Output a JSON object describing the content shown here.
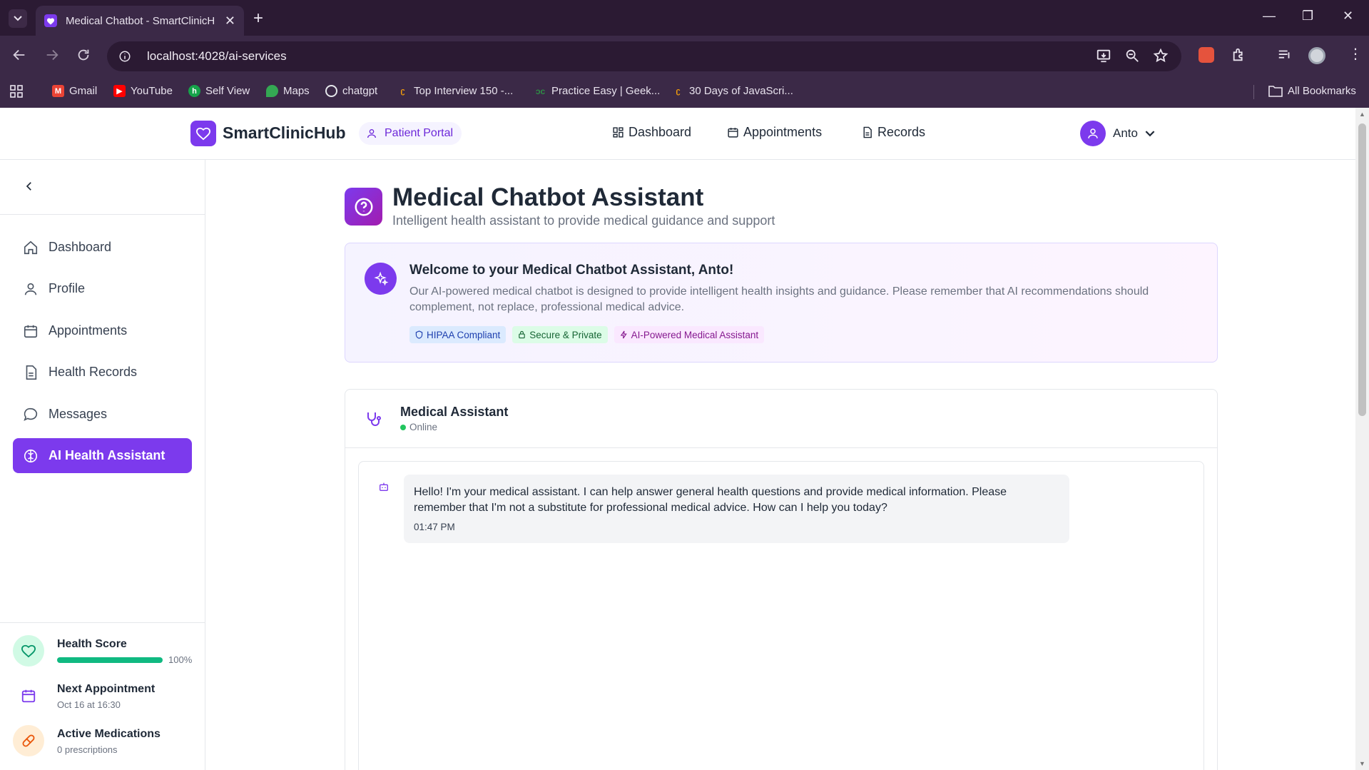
{
  "browser": {
    "tab_title": "Medical Chatbot - SmartClinicH",
    "url": "localhost:4028/ai-services",
    "bookmarks": [
      {
        "label": "Gmail",
        "icon": "gmail-icon",
        "color": "#ea4335"
      },
      {
        "label": "YouTube",
        "icon": "youtube-icon",
        "color": "#ff0000"
      },
      {
        "label": "Self View",
        "icon": "selfview-icon",
        "color": "#16a34a"
      },
      {
        "label": "Maps",
        "icon": "maps-icon",
        "color": "#34a853"
      },
      {
        "label": "chatgpt",
        "icon": "chatgpt-icon",
        "color": "#e5e7eb"
      },
      {
        "label": "Top Interview 150 -...",
        "icon": "leetcode-icon",
        "color": "#f59e0b"
      },
      {
        "label": "Practice Easy | Geek...",
        "icon": "gfg-icon",
        "color": "#2f8d46"
      },
      {
        "label": "30 Days of JavaScri...",
        "icon": "leetcode-icon",
        "color": "#f59e0b"
      }
    ],
    "all_bookmarks": "All Bookmarks"
  },
  "header": {
    "brand": "SmartClinicHub",
    "portal": "Patient Portal",
    "nav": [
      "Dashboard",
      "Appointments",
      "Records"
    ],
    "user": "Anto"
  },
  "sidebar": {
    "items": [
      {
        "label": "Dashboard",
        "icon": "home-icon"
      },
      {
        "label": "Profile",
        "icon": "user-icon"
      },
      {
        "label": "Appointments",
        "icon": "calendar-icon"
      },
      {
        "label": "Health Records",
        "icon": "file-icon"
      },
      {
        "label": "Messages",
        "icon": "message-icon"
      },
      {
        "label": "AI Health Assistant",
        "icon": "brain-icon",
        "active": true
      }
    ],
    "stats": {
      "health_score": {
        "title": "Health Score",
        "value": "100%",
        "fraction": 1.0
      },
      "next_appointment": {
        "title": "Next Appointment",
        "sub": "Oct 16 at 16:30"
      },
      "medications": {
        "title": "Active Medications",
        "sub": "0 prescriptions"
      }
    }
  },
  "main": {
    "title": "Medical Chatbot Assistant",
    "subtitle": "Intelligent health assistant to provide medical guidance and support",
    "welcome": {
      "title": "Welcome to your Medical Chatbot Assistant, Anto!",
      "text": "Our AI-powered medical chatbot is designed to provide intelligent health insights and guidance. Please remember that AI recommendations should complement, not replace, professional medical advice.",
      "badges": [
        "HIPAA Compliant",
        "Secure & Private",
        "AI-Powered Medical Assistant"
      ]
    },
    "chat": {
      "title": "Medical Assistant",
      "status": "Online",
      "messages": [
        {
          "text": "Hello! I'm your medical assistant. I can help answer general health questions and provide medical information. Please remember that I'm not a substitute for professional medical advice. How can I help you today?",
          "time": "01:47 PM"
        }
      ]
    }
  },
  "colors": {
    "accent": "#7c3aed",
    "success": "#10b981",
    "chrome_bg": "#2b1a33"
  }
}
